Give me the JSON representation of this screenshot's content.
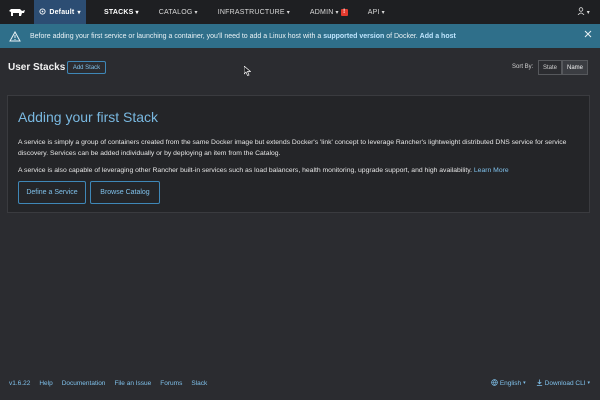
{
  "nav": {
    "environment": "Default",
    "items": [
      {
        "label": "STACKS",
        "chevron": "▾"
      },
      {
        "label": "CATALOG",
        "chevron": "▾"
      },
      {
        "label": "INFRASTRUCTURE",
        "chevron": "▾"
      },
      {
        "label": "ADMIN",
        "chevron": "▾"
      },
      {
        "label": "API",
        "chevron": "▾"
      }
    ],
    "admin_badge": "!"
  },
  "banner": {
    "text_before": "Before adding your first service or launching a container, you'll need to add a Linux host with a ",
    "link_supported": "supported version",
    "text_middle": " of Docker. ",
    "link_add_host": "Add a host"
  },
  "header": {
    "title": "User Stacks",
    "add_button": "Add Stack",
    "sort_label": "Sort By:",
    "sort_options": [
      "State",
      "Name"
    ]
  },
  "panel": {
    "title": "Adding your first Stack",
    "paragraph1": "A service is simply a group of containers created from the same Docker image but extends Docker's 'link' concept to leverage Rancher's lightweight distributed DNS service for service discovery. Services can be added individually or by deploying an item from the Catalog.",
    "paragraph2": "A service is also capable of leveraging other Rancher built-in services such as load balancers, health monitoring, upgrade support, and high availability. ",
    "learn_more": "Learn More",
    "btn_define": "Define a Service",
    "btn_browse": "Browse Catalog"
  },
  "footer": {
    "version": "v1.6.22",
    "links": [
      "Help",
      "Documentation",
      "File an Issue",
      "Forums",
      "Slack"
    ],
    "language": "English",
    "download": "Download CLI"
  },
  "colors": {
    "accent": "#3f87b7",
    "banner": "#2f6f8a",
    "env": "#2c4d73",
    "badge": "#e33a2e"
  }
}
